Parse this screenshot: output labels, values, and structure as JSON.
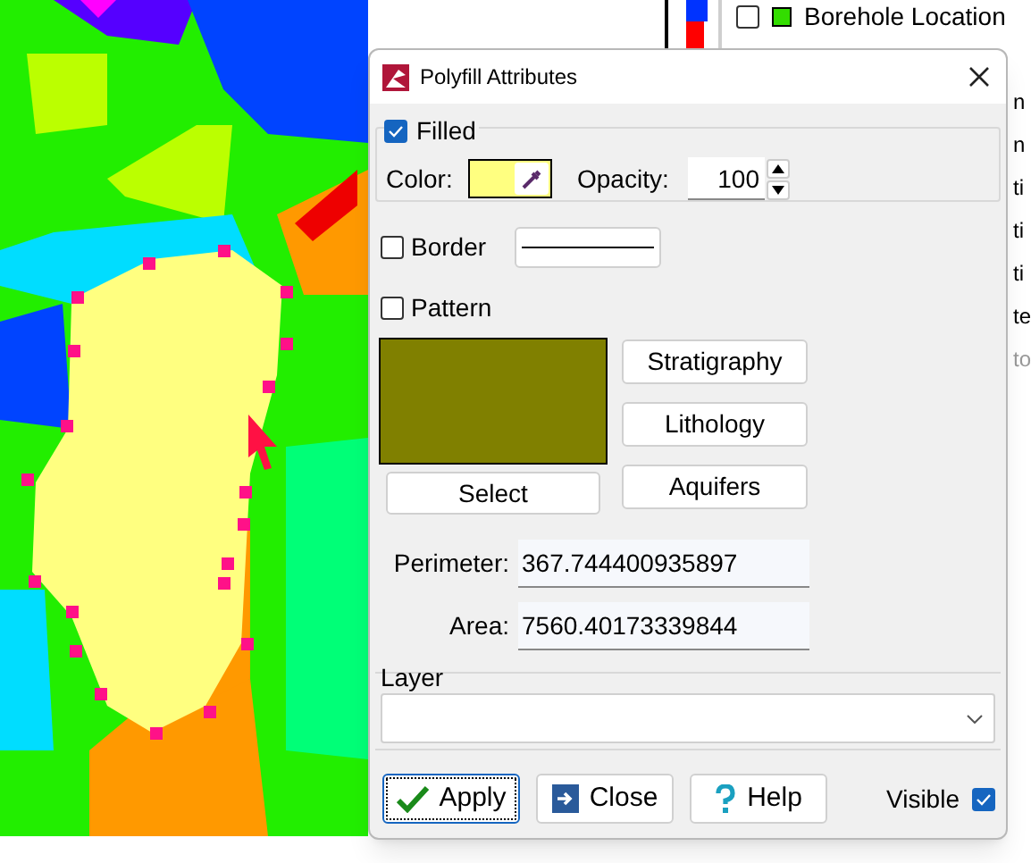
{
  "legend": {
    "rows": [
      {
        "label": "Borehole Location",
        "checked": false,
        "color": "#33dd00"
      }
    ]
  },
  "side_fragments": [
    "n",
    "n",
    "ti",
    "ti",
    "ti",
    "te",
    "to"
  ],
  "dialog": {
    "title": "Polyfill Attributes",
    "filled": {
      "label": "Filled",
      "checked": true
    },
    "color": {
      "label": "Color:",
      "color": "#ffff80"
    },
    "opacity": {
      "label": "Opacity:",
      "value": "100"
    },
    "border": {
      "label": "Border",
      "checked": false
    },
    "pattern": {
      "label": "Pattern",
      "checked": false,
      "color": "#808000"
    },
    "select_button": "Select",
    "pattern_buttons": [
      "Stratigraphy",
      "Lithology",
      "Aquifers"
    ],
    "perimeter": {
      "label": "Perimeter:",
      "value": "367.744400935897"
    },
    "area": {
      "label": "Area:",
      "value": "7560.40173339844"
    },
    "layer": {
      "label": "Layer"
    },
    "buttons": [
      {
        "label": "Apply",
        "kind": "apply"
      },
      {
        "label": "Close",
        "kind": "close"
      },
      {
        "label": "Help",
        "kind": "help"
      }
    ],
    "visible": {
      "label": "Visible",
      "checked": true
    }
  }
}
